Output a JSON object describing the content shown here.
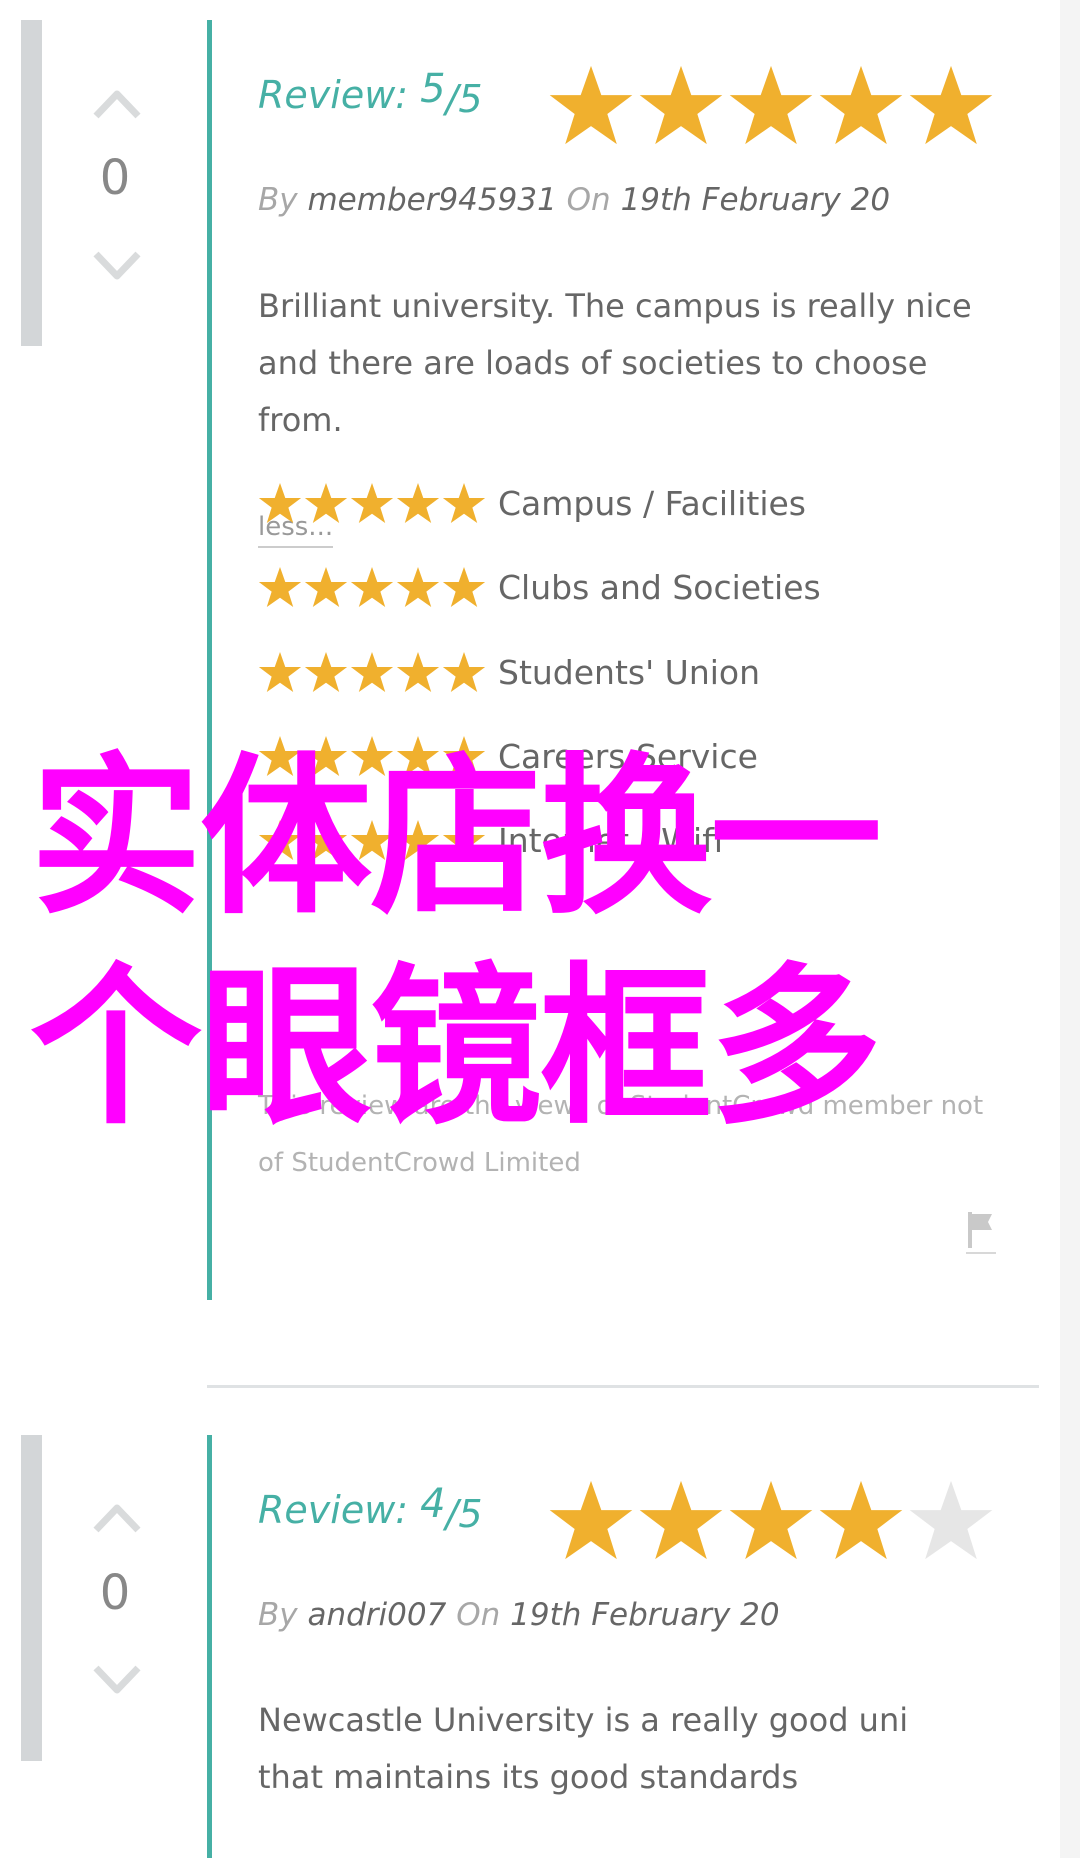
{
  "colors": {
    "accent_teal": "#46b0a5",
    "star_filled": "#f0b02e",
    "star_empty": "#e6e6e6",
    "vote_bar": "#d3d6d8",
    "watermark": "#ff00ff"
  },
  "reviews": [
    {
      "votes": "0",
      "title_label": "Review:",
      "score": "5",
      "out_of": "/5",
      "rating_stars": 5,
      "by_label": "By",
      "author": "member945931",
      "on_label": "On",
      "date": "19th February 20",
      "text": "Brilliant university. The campus is really nice and there are loads of societies to choose from.",
      "less_label": "less...",
      "categories": [
        {
          "label": "Campus / Facilities",
          "stars": 5
        },
        {
          "label": "Clubs and Societies",
          "stars": 5
        },
        {
          "label": "Students' Union",
          "stars": 5
        },
        {
          "label": "Careers Service",
          "stars": 5
        },
        {
          "label": "Internet / Wifi",
          "stars": 5
        }
      ],
      "disclaimer": "This review are the views of StudentCrowd member not of StudentCrowd Limited"
    },
    {
      "votes": "0",
      "title_label": "Review:",
      "score": "4",
      "out_of": "/5",
      "rating_stars": 4,
      "by_label": "By",
      "author": "andri007",
      "on_label": "On",
      "date": "19th February 20",
      "text": "Newcastle University is a really good uni that maintains its good standards"
    }
  ],
  "watermark": {
    "line1": "实体店换一",
    "line2": "个眼镜框多"
  },
  "icons": {
    "vote_up": "chevron-up-icon",
    "vote_down": "chevron-down-icon",
    "star": "star-icon",
    "flag": "flag-icon"
  }
}
